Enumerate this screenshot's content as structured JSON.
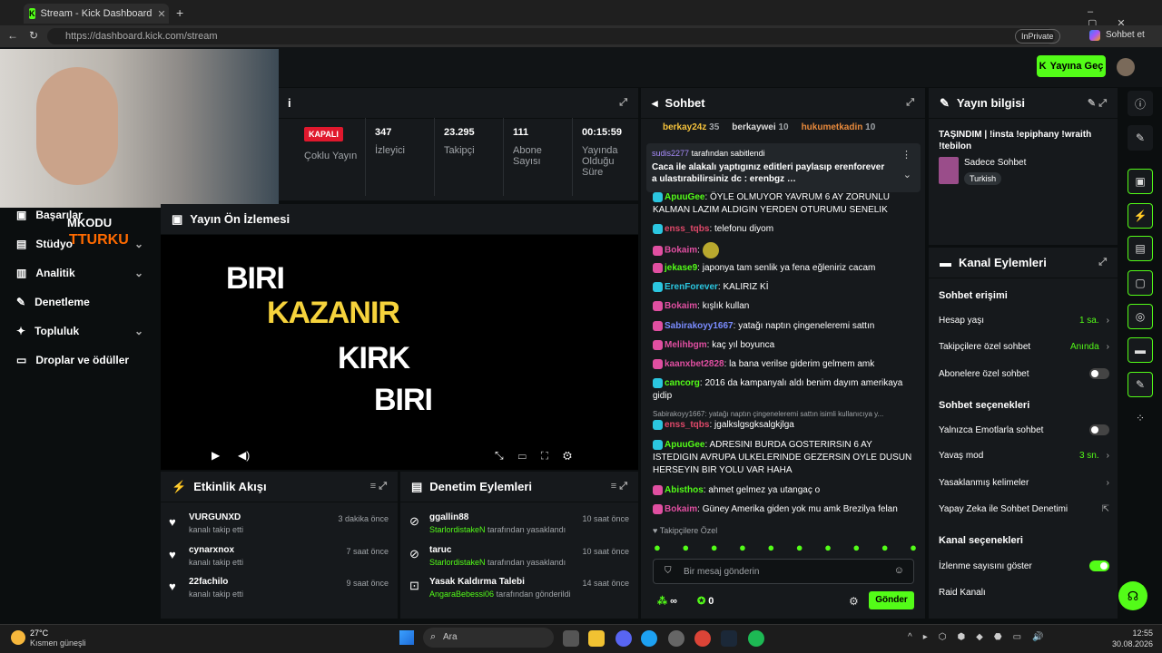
{
  "browser": {
    "tab_title": "Stream - Kick Dashboard",
    "url": "https://dashboard.kick.com/stream",
    "inprivate": "InPrivate",
    "chat_btn": "Sohbet et"
  },
  "header": {
    "go_live": "Yayına Geç"
  },
  "watermark": {
    "line1": "MKODU",
    "line2": "TTURKU"
  },
  "sidebar": {
    "items": [
      {
        "label": "Başarılar"
      },
      {
        "label": "Stüdyo"
      },
      {
        "label": "Analitik"
      },
      {
        "label": "Denetleme"
      },
      {
        "label": "Topluluk"
      },
      {
        "label": "Droplar ve ödüller"
      }
    ]
  },
  "stats": {
    "status": "KAPALI",
    "multi": "Çoklu Yayın",
    "viewers": {
      "value": "347",
      "label": "İzleyici"
    },
    "followers": {
      "value": "23.295",
      "label": "Takipçi"
    },
    "subs": {
      "value": "111",
      "label": "Abone Sayısı"
    },
    "uptime": {
      "value": "00:15:59",
      "label": "Yayında Olduğu Süre"
    }
  },
  "preview": {
    "title": "Yayın Ön İzlemesi",
    "line1": "BIRI",
    "line2": "KAZANIR",
    "line3": "KIRK",
    "line4": "BIRI"
  },
  "activity": {
    "title": "Etkinlik Akışı",
    "items": [
      {
        "name": "VURGUNXD",
        "desc": "kanalı takip etti",
        "time": "3 dakika önce"
      },
      {
        "name": "cynarxnox",
        "desc": "kanalı takip etti",
        "time": "7 saat önce"
      },
      {
        "name": "22fachilo",
        "desc": "kanalı takip etti",
        "time": "9 saat önce"
      }
    ]
  },
  "moderation": {
    "title": "Denetim Eylemleri",
    "items": [
      {
        "name": "ggallin88",
        "by": "StarlordistakeN",
        "desc": "tarafından yasaklandı",
        "time": "10 saat önce"
      },
      {
        "name": "taruc",
        "by": "StarlordistakeN",
        "desc": "tarafından yasaklandı",
        "time": "10 saat önce"
      },
      {
        "name": "Yasak Kaldırma Talebi",
        "by": "AngaraBebessi06",
        "desc": "tarafından gönderildi",
        "time": "14 saat önce"
      }
    ]
  },
  "chat": {
    "title": "Sohbet",
    "top": [
      {
        "name": "berkay24z",
        "n": "35"
      },
      {
        "name": "berkaywei",
        "n": "10"
      },
      {
        "name": "hukumetkadin",
        "n": "10"
      }
    ],
    "pinned_by": "sudis2277",
    "pinned_label": "tarafından sabitlendi",
    "pinned_text": "Caca ile alakalı yaptıgınız editleri paylasıp erenforever a ulastırabilirsiniz dc : erenbgz …",
    "messages": [
      {
        "user": "ApuuGee",
        "color": "#53fc18",
        "text": "ÖYLE OLMUYOR YAVRUM 6 AY ZORUNLU KALMAN LAZIM ALDIGIN YERDEN OTURUMU SENELIK"
      },
      {
        "user": "enss_tqbs",
        "color": "#e0496a",
        "text": "telefonu diyom"
      },
      {
        "user": "Bokaim",
        "color": "#e04fa1",
        "text": ""
      },
      {
        "user": "jekase9",
        "color": "#53fc18",
        "text": "japonya tam senlik ya fena eğleniriz cacam"
      },
      {
        "user": "ErenForever",
        "color": "#2bc6e0",
        "text": "KALIRIZ Kİ"
      },
      {
        "user": "Bokaim",
        "color": "#e04fa1",
        "text": "kışlık kullan"
      },
      {
        "user": "Sabirakoyy1667",
        "color": "#7a8cff",
        "text": "yatağı naptın çingeneleremi sattın"
      },
      {
        "user": "Melihbgm",
        "color": "#e04fa1",
        "text": "kaç yıl boyunca"
      },
      {
        "user": "kaanxbet2828",
        "color": "#e04fa1",
        "text": "la bana verilse giderim gelmem amk"
      },
      {
        "user": "cancorg",
        "color": "#53fc18",
        "text": "2016 da kampanyalı aldı benim dayım amerikaya gidip"
      },
      {
        "user": "enss_tqbs",
        "color": "#e0496a",
        "text": "jgalkslgsgksalgkjlga"
      },
      {
        "user": "ApuuGee",
        "color": "#53fc18",
        "text": "ADRESINI BURDA GOSTERIRSIN 6 AY ISTEDIGIN AVRUPA ULKELERINDE GEZERSIN OYLE DUSUN HERSEYIN BIR YOLU VAR HAHA"
      },
      {
        "user": "Abisthos",
        "color": "#53fc18",
        "text": "ahmet gelmez ya utangaç o"
      },
      {
        "user": "Bokaim",
        "color": "#e04fa1",
        "text": "Güney Amerika giden yok mu amk Brezilya felan"
      }
    ],
    "reply_hint": "Sabirakoyy1667: yatağı naptın çingeneleremi sattın isimli kullanıcıya y...",
    "followers_only": "Takipçilere Özel",
    "input_placeholder": "Bir mesaj gönderin",
    "infinity": "∞",
    "points": "0",
    "send": "Gönder"
  },
  "stream_info": {
    "title": "Yayın bilgisi",
    "stream_title": "TAŞINDIM | !insta !epiphany !wraith !tebilon",
    "category": "Sadece Sohbet",
    "tag": "Turkish"
  },
  "channel_actions": {
    "title": "Kanal Eylemleri",
    "access_heading": "Sohbet erişimi",
    "account_age": {
      "label": "Hesap yaşı",
      "value": "1 sa."
    },
    "followers_only": {
      "label": "Takipçilere özel sohbet",
      "value": "Anında"
    },
    "subs_only": {
      "label": "Abonelere özel sohbet"
    },
    "options_heading": "Sohbet seçenekleri",
    "emotes_only": {
      "label": "Yalnızca Emotlarla sohbet"
    },
    "slow_mode": {
      "label": "Yavaş mod",
      "value": "3 sn."
    },
    "banned_words": {
      "label": "Yasaklanmış kelimeler"
    },
    "ai_mod": {
      "label": "Yapay Zeka ile Sohbet Denetimi"
    },
    "channel_heading": "Kanal seçenekleri",
    "show_viewers": {
      "label": "İzlenme sayısını göster"
    },
    "raid": {
      "label": "Raid Kanalı"
    }
  },
  "taskbar": {
    "temp": "27°C",
    "weather": "Kısmen güneşli",
    "search": "Ara",
    "time": "12:55",
    "date": "30.08.2026"
  },
  "colors": {
    "accent": "#53fc18",
    "panel": "#16191c",
    "bg": "#0b0e0f"
  }
}
